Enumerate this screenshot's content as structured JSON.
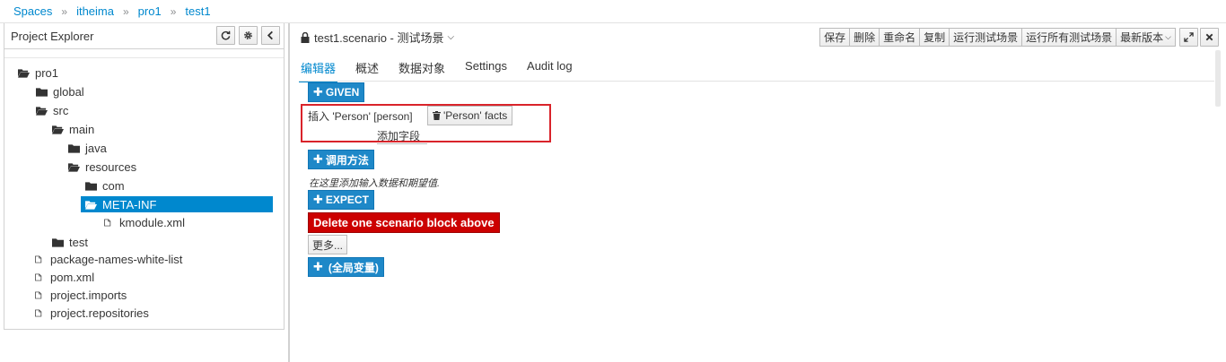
{
  "breadcrumb": {
    "items": [
      "Spaces",
      "itheima",
      "pro1",
      "test1"
    ],
    "separator": "»"
  },
  "explorer": {
    "title": "Project Explorer",
    "tree": [
      {
        "label": "pro1",
        "type": "folder-open"
      },
      {
        "label": "global",
        "type": "folder"
      },
      {
        "label": "src",
        "type": "folder-open"
      },
      {
        "label": "main",
        "type": "folder-open"
      },
      {
        "label": "java",
        "type": "folder"
      },
      {
        "label": "resources",
        "type": "folder-open"
      },
      {
        "label": "com",
        "type": "folder"
      },
      {
        "label": "META-INF",
        "type": "folder-open",
        "selected": true
      },
      {
        "label": "kmodule.xml",
        "type": "file"
      },
      {
        "label": "test",
        "type": "folder"
      },
      {
        "label": "package-names-white-list",
        "type": "file"
      },
      {
        "label": "pom.xml",
        "type": "file"
      },
      {
        "label": "project.imports",
        "type": "file"
      },
      {
        "label": "project.repositories",
        "type": "file"
      }
    ]
  },
  "editor": {
    "title": "test1.scenario - 测试场景",
    "toolbar": [
      "保存",
      "删除",
      "重命名",
      "复制",
      "运行测试场景",
      "运行所有测试场景",
      "最新版本"
    ],
    "tabs": [
      "编辑器",
      "概述",
      "数据对象",
      "Settings",
      "Audit log"
    ],
    "active_tab": "编辑器",
    "given_label": "GIVEN",
    "insert_label": "插入 'Person' [person]",
    "facts_label": "'Person' facts",
    "add_field_label": "添加字段",
    "call_method_label": "调用方法",
    "hint": "在这里添加输入数据和期望值.",
    "expect_label": "EXPECT",
    "delete_block_label": "Delete one scenario block above",
    "more_label": "更多...",
    "globals_label": "(全局变量)"
  },
  "colors": {
    "accent": "#0088ce",
    "primary_button": "#1e88c8",
    "danger": "#cc0000",
    "highlight_box": "#d9232a"
  }
}
